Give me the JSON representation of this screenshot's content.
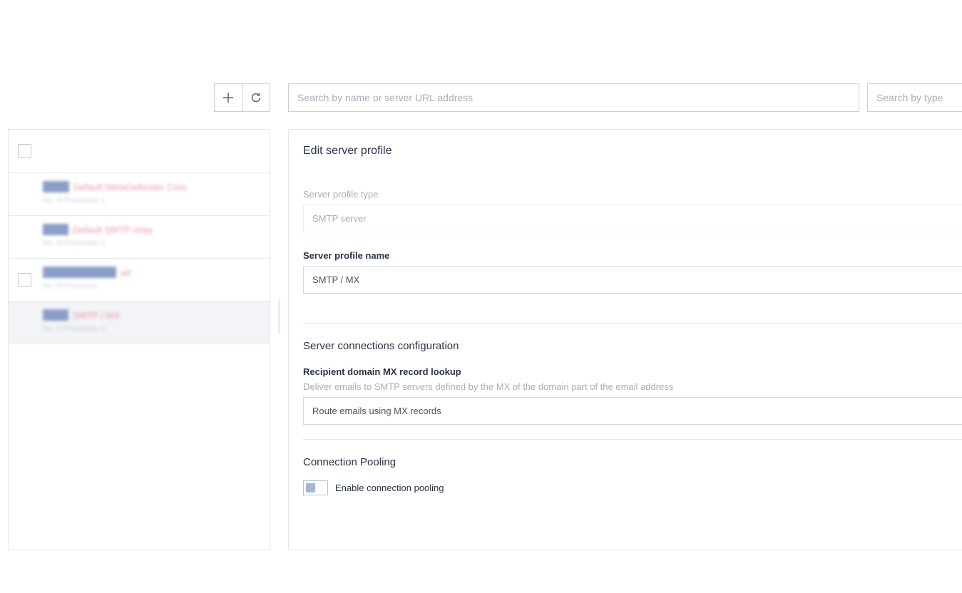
{
  "toolbar": {
    "add_icon": "plus-icon",
    "refresh_icon": "refresh-icon",
    "search_placeholder": "Search by name or server URL address",
    "type_placeholder": "Search by type"
  },
  "list": {
    "items": [
      {
        "tag": "CORE",
        "name": "Default MetaDefender Core",
        "subtitle": "No. of Processes: 1",
        "selected": false,
        "has_checkbox": false
      },
      {
        "tag": "SMTP",
        "name": "Default SMTP relay",
        "subtitle": "No. of Processes: 1",
        "selected": false,
        "has_checkbox": false
      },
      {
        "tag": "SMTP CONNECTOR",
        "name": "ad",
        "subtitle": "No. of Processes",
        "selected": false,
        "has_checkbox": true
      },
      {
        "tag": "SMTP",
        "name": "SMTP / MX",
        "subtitle": "No. of Processes: 0",
        "selected": true,
        "has_checkbox": false
      }
    ]
  },
  "form": {
    "title": "Edit server profile",
    "type_label": "Server profile type",
    "type_value": "SMTP server",
    "name_label": "Server profile name",
    "name_value": "SMTP / MX",
    "connections_title": "Server connections configuration",
    "mx_label": "Recipient domain MX record lookup",
    "mx_help": "Deliver emails to SMTP servers defined by the MX of the domain part of the email address",
    "mx_value": "Route emails using MX records",
    "pooling_title": "Connection Pooling",
    "pooling_toggle_label": "Enable connection pooling"
  },
  "colors": {
    "accent": "#a8b5d6",
    "border": "#c9ced8",
    "text": "#2a3447",
    "muted": "#a7adb9"
  }
}
